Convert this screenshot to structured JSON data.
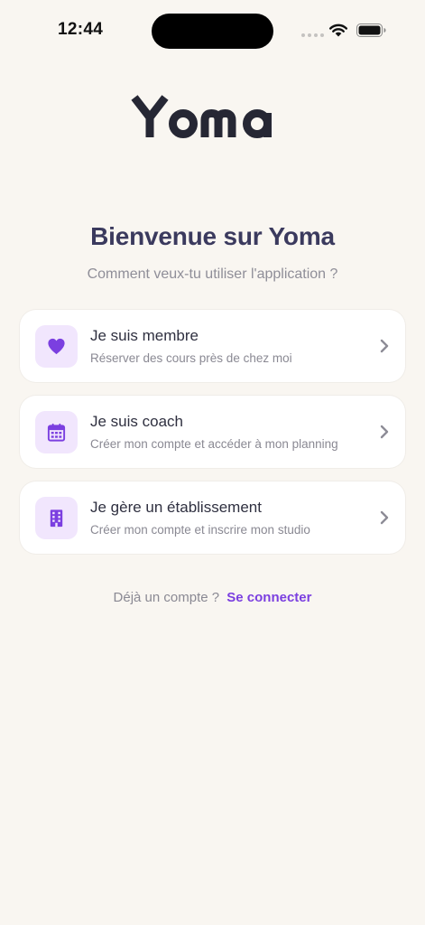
{
  "status_bar": {
    "time": "12:44"
  },
  "brand": {
    "logo_text": "Yoma",
    "logo_color": "#262734",
    "accent_color": "#7b3fe0",
    "icon_bg_color": "#f1e6fd"
  },
  "welcome": {
    "title": "Bienvenue sur Yoma",
    "subtitle": "Comment veux-tu utiliser l'application ?"
  },
  "options": [
    {
      "icon": "heart-icon",
      "title": "Je suis membre",
      "description": "Réserver des cours près de chez moi"
    },
    {
      "icon": "calendar-icon",
      "title": "Je suis coach",
      "description": "Créer mon compte et accéder à mon planning"
    },
    {
      "icon": "building-icon",
      "title": "Je gère un établissement",
      "description": "Créer mon compte et inscrire mon studio"
    }
  ],
  "login": {
    "prompt": "Déjà un compte ?",
    "link_label": "Se connecter"
  }
}
